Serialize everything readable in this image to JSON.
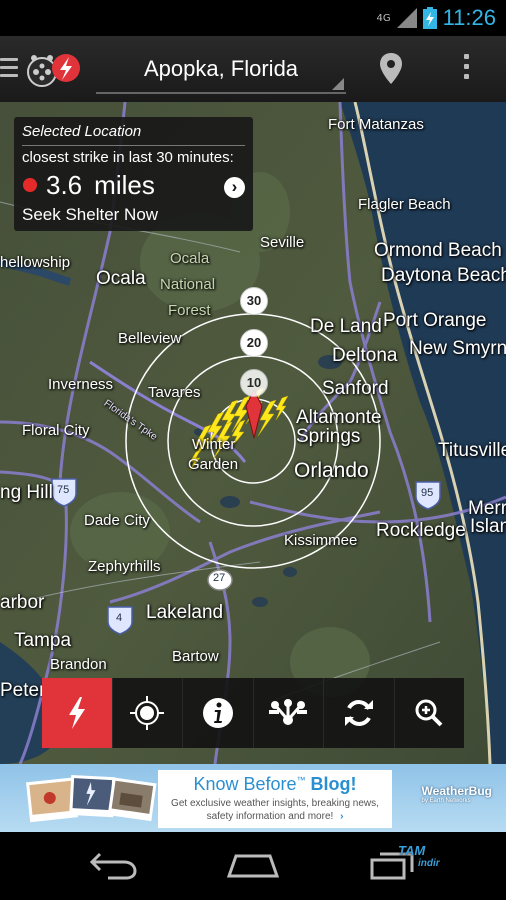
{
  "status_bar": {
    "network": "4G",
    "time": "11:26",
    "accent_color": "#33b5e5"
  },
  "action_bar": {
    "location": "Apopka, Florida",
    "icons": [
      "menu-icon",
      "app-logo-icon",
      "location-pin-icon",
      "overflow-menu-icon"
    ]
  },
  "info_card": {
    "title": "Selected Location",
    "subtitle": "closest strike in last 30 minutes:",
    "distance_value": "3.6",
    "distance_unit": "miles",
    "advice": "Seek Shelter Now",
    "alert_color": "#e52a2a"
  },
  "range_rings": [
    "30",
    "20",
    "10"
  ],
  "map_labels": [
    "Fort Matanzas",
    "Flagler Beach",
    "Ormond Beach",
    "Daytona Beach",
    "Port Orange",
    "New Smyrna Bea",
    "Seville",
    "De Land",
    "Deltona",
    "Sanford",
    "Altamonte",
    "Springs",
    "Orlando",
    "Titusville",
    "Merr",
    "Island",
    "Rockledge",
    "Kissimmee",
    "Ocala",
    "Ocala",
    "National",
    "Forest",
    "Belleview",
    "Tavares",
    "Winter",
    "Garden",
    "Inverness",
    "Floral City",
    "Dade City",
    "Zephyrhills",
    "Lakeland",
    "Bartow",
    "Brandon",
    "Tampa",
    "hellowship",
    "ng Hill",
    "arbor",
    "Peters",
    "75",
    "95",
    "27",
    "4",
    "Florida's Tpke"
  ],
  "toolbar": {
    "items": [
      "lightning-icon",
      "crosshair-locate-icon",
      "info-icon",
      "share-network-icon",
      "refresh-icon",
      "zoom-search-icon"
    ],
    "active": "lightning-icon",
    "active_color": "#e0333a"
  },
  "ad": {
    "headline": "Know Before",
    "tm": "™",
    "blog": "Blog!",
    "body": "Get exclusive weather insights, breaking news, safety information and more!",
    "chevron": "›",
    "brand": "WeatherBug",
    "brand_sub": "by Earth Networks"
  },
  "watermark": {
    "line1": "TAM",
    "line2": "indir"
  }
}
